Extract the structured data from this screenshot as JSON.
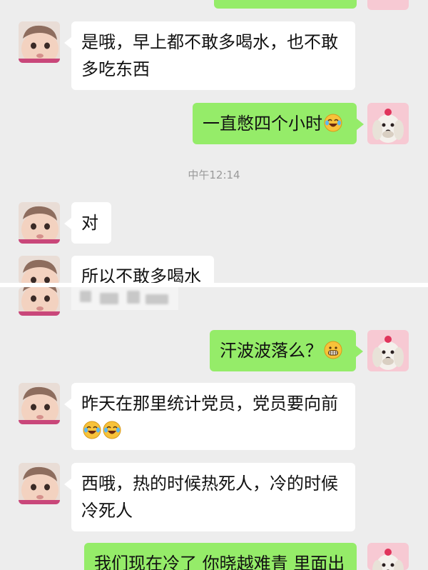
{
  "colors": {
    "background": "#ededed",
    "sent_bubble": "#95ec69",
    "received_bubble": "#ffffff",
    "timestamp": "#9a9a9a"
  },
  "timestamp": "中午12:14",
  "messages": [
    {
      "side": "left",
      "line1": "是哦，早上都不敢多喝水，也不敢",
      "line2": "多吃东西"
    },
    {
      "side": "right",
      "text": "一直憋四个小时",
      "emoji": "crying-laughing-emoji"
    },
    {
      "side": "left",
      "text": "对"
    },
    {
      "side": "left",
      "text": "所以不敢多喝水"
    },
    {
      "side": "right",
      "text": "汗波波落么？",
      "emoji": "grinning-emoji"
    },
    {
      "side": "left",
      "line1": "昨天在那里统计党员，党员要向前",
      "emoji": "crying-laughing-emoji"
    },
    {
      "side": "left",
      "line1": "西哦，热的时候热死人，冷的时候",
      "line2": "冷死人"
    },
    {
      "side": "right",
      "text": "我们现在冷了 你晓越难青 里面出"
    }
  ]
}
